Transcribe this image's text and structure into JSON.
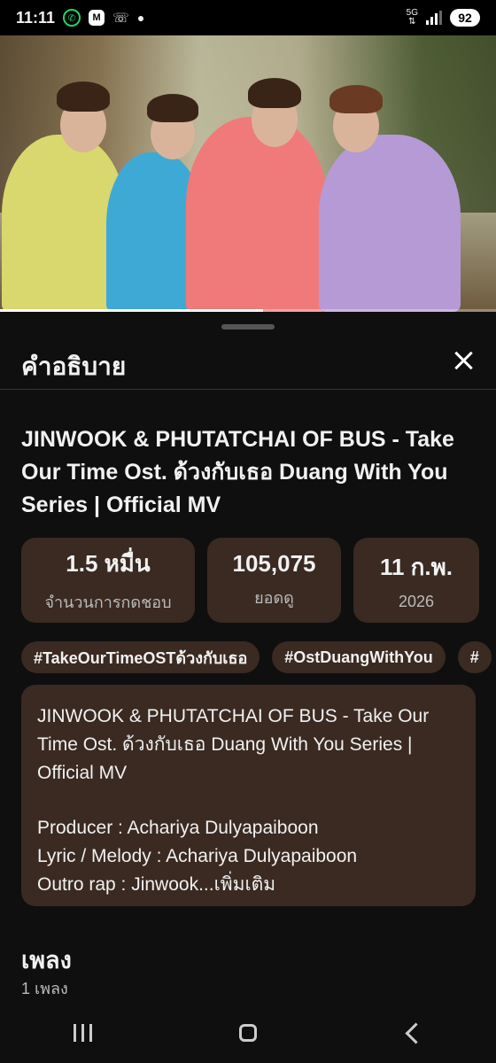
{
  "status_bar": {
    "time": "11:11",
    "network": "5G",
    "battery": "92",
    "icons": [
      "whatsapp-icon",
      "m-app-icon",
      "missed-call-icon",
      "notification-dot-icon",
      "signal-icon",
      "battery-icon"
    ]
  },
  "video": {
    "progress_fraction": 0.53
  },
  "sheet": {
    "title": "คำอธิบาย",
    "video_title": "JINWOOK & PHUTATCHAI OF BUS - Take Our Time Ost. ด้วงกับเธอ Duang With You Series | Official MV",
    "stats": [
      {
        "value": "1.5 หมื่น",
        "label": "จำนวนการกดชอบ"
      },
      {
        "value": "105,075",
        "label": "ยอดดู"
      },
      {
        "value": "11 ก.พ.",
        "label": "2026"
      }
    ],
    "tags": [
      "#TakeOurTimeOSTด้วงกับเธอ",
      "#OstDuangWithYou",
      "#"
    ],
    "description": {
      "line1": "JINWOOK & PHUTATCHAI OF BUS - Take Our Time Ost. ด้วงกับเธอ Duang With You Series | Official MV",
      "producer": "Producer : Achariya Dulyapaiboon",
      "lyric": "Lyric / Melody : Achariya Dulyapaiboon",
      "outro": "Outro rap : Jinwook",
      "more": "...เพิ่มเติม"
    },
    "songs_title": "เพลง",
    "songs_count": "1 เพลง"
  },
  "colors": {
    "background": "#0f0f0f",
    "card": "#3a2a22",
    "text": "#f1f1f1",
    "muted": "#bbbbbb"
  }
}
